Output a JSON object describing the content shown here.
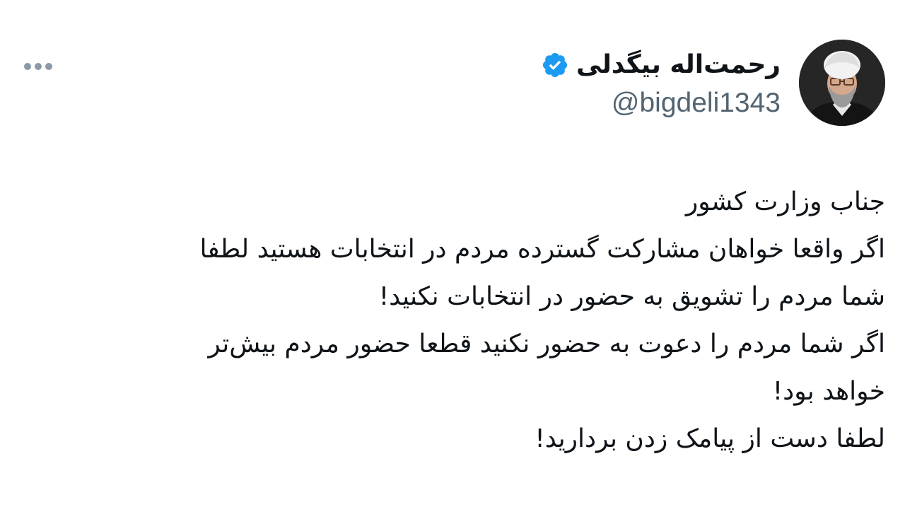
{
  "author": {
    "display_name": "رحمت‌اله بیگدلی",
    "handle": "@bigdeli1343",
    "verified": true,
    "verified_color": "#1d9bf0",
    "avatar_alt": "avatar"
  },
  "menu": {
    "icon": "more-horizontal-icon"
  },
  "tweet": {
    "lines": [
      "جناب وزارت کشور",
      "اگر واقعا خواهان مشارکت گسترده مردم در انتخابات هستید لطفا",
      "شما مردم را تشویق به حضور در انتخابات نکنید!",
      "اگر شما مردم را دعوت به حضور نکنید قطعا حضور مردم بیش‌تر",
      "خواهد بود!",
      "لطفا دست از پیامک زدن بردارید!"
    ]
  },
  "colors": {
    "text": "#0f1419",
    "secondary": "#536471",
    "icon_gray": "#8b98a5",
    "background": "#ffffff"
  }
}
